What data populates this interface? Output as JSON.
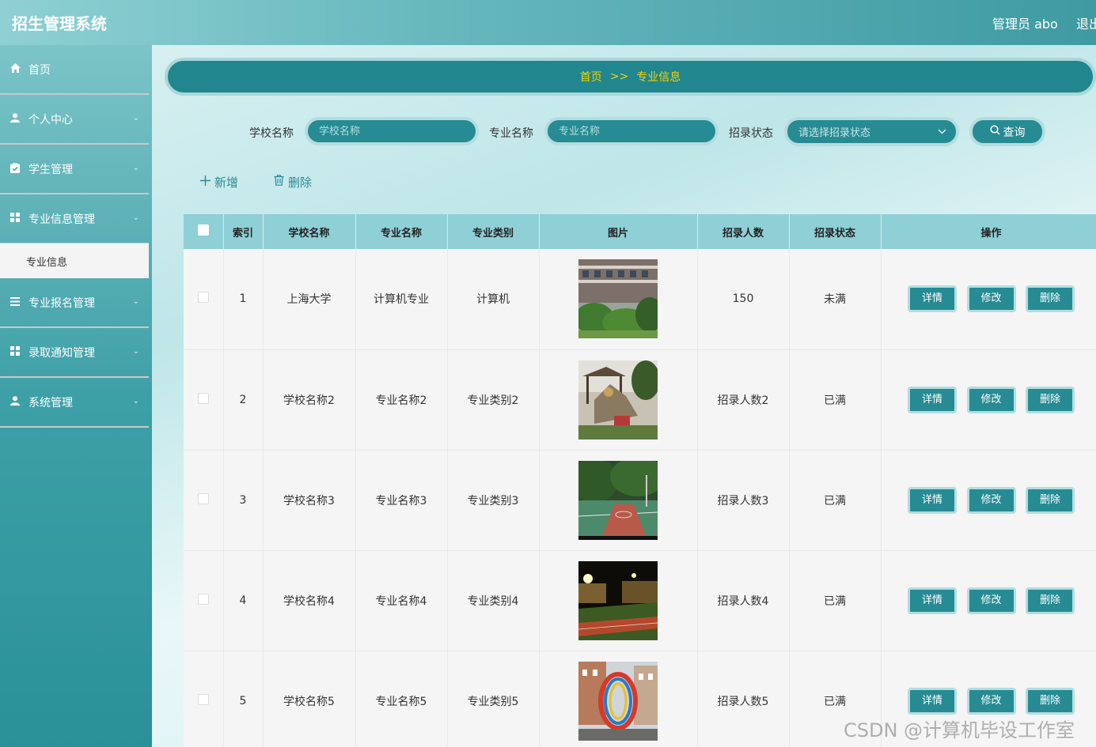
{
  "header": {
    "app_title": "招生管理系统",
    "user_label": "管理员 abo",
    "logout_label": "退出"
  },
  "sidebar": {
    "items": [
      {
        "label": "首页",
        "icon": "home-icon"
      },
      {
        "label": "个人中心",
        "icon": "user-icon"
      },
      {
        "label": "学生管理",
        "icon": "clipboard-icon"
      },
      {
        "label": "专业信息管理",
        "icon": "grid-icon"
      },
      {
        "label": "专业报名管理",
        "icon": "list-icon"
      },
      {
        "label": "录取通知管理",
        "icon": "grid-icon"
      },
      {
        "label": "系统管理",
        "icon": "user-icon"
      }
    ],
    "active_sub": "专业信息"
  },
  "breadcrumb": {
    "home": "首页",
    "sep": ">>",
    "current": "专业信息"
  },
  "search": {
    "school_label": "学校名称",
    "school_placeholder": "学校名称",
    "major_label": "专业名称",
    "major_placeholder": "专业名称",
    "status_label": "招录状态",
    "status_placeholder": "请选择招录状态",
    "query_label": "查询"
  },
  "actions": {
    "add_label": "新增",
    "delete_label": "删除"
  },
  "table": {
    "columns": [
      "索引",
      "学校名称",
      "专业名称",
      "专业类别",
      "图片",
      "招录人数",
      "招录状态",
      "操作"
    ],
    "rows": [
      {
        "index": "1",
        "school": "上海大学",
        "major": "计算机专业",
        "category": "计算机",
        "count": "150",
        "status": "未满"
      },
      {
        "index": "2",
        "school": "学校名称2",
        "major": "专业名称2",
        "category": "专业类别2",
        "count": "招录人数2",
        "status": "已满"
      },
      {
        "index": "3",
        "school": "学校名称3",
        "major": "专业名称3",
        "category": "专业类别3",
        "count": "招录人数3",
        "status": "已满"
      },
      {
        "index": "4",
        "school": "学校名称4",
        "major": "专业名称4",
        "category": "专业类别4",
        "count": "招录人数4",
        "status": "已满"
      },
      {
        "index": "5",
        "school": "学校名称5",
        "major": "专业名称5",
        "category": "专业类别5",
        "count": "招录人数5",
        "status": "已满"
      }
    ],
    "row_buttons": {
      "detail": "详情",
      "edit": "修改",
      "delete": "删除"
    }
  },
  "watermark": "CSDN @计算机毕设工作室",
  "colors": {
    "accent": "#268b93",
    "breadcrumb_text": "#f5d300",
    "table_header": "#8fd0d7"
  }
}
